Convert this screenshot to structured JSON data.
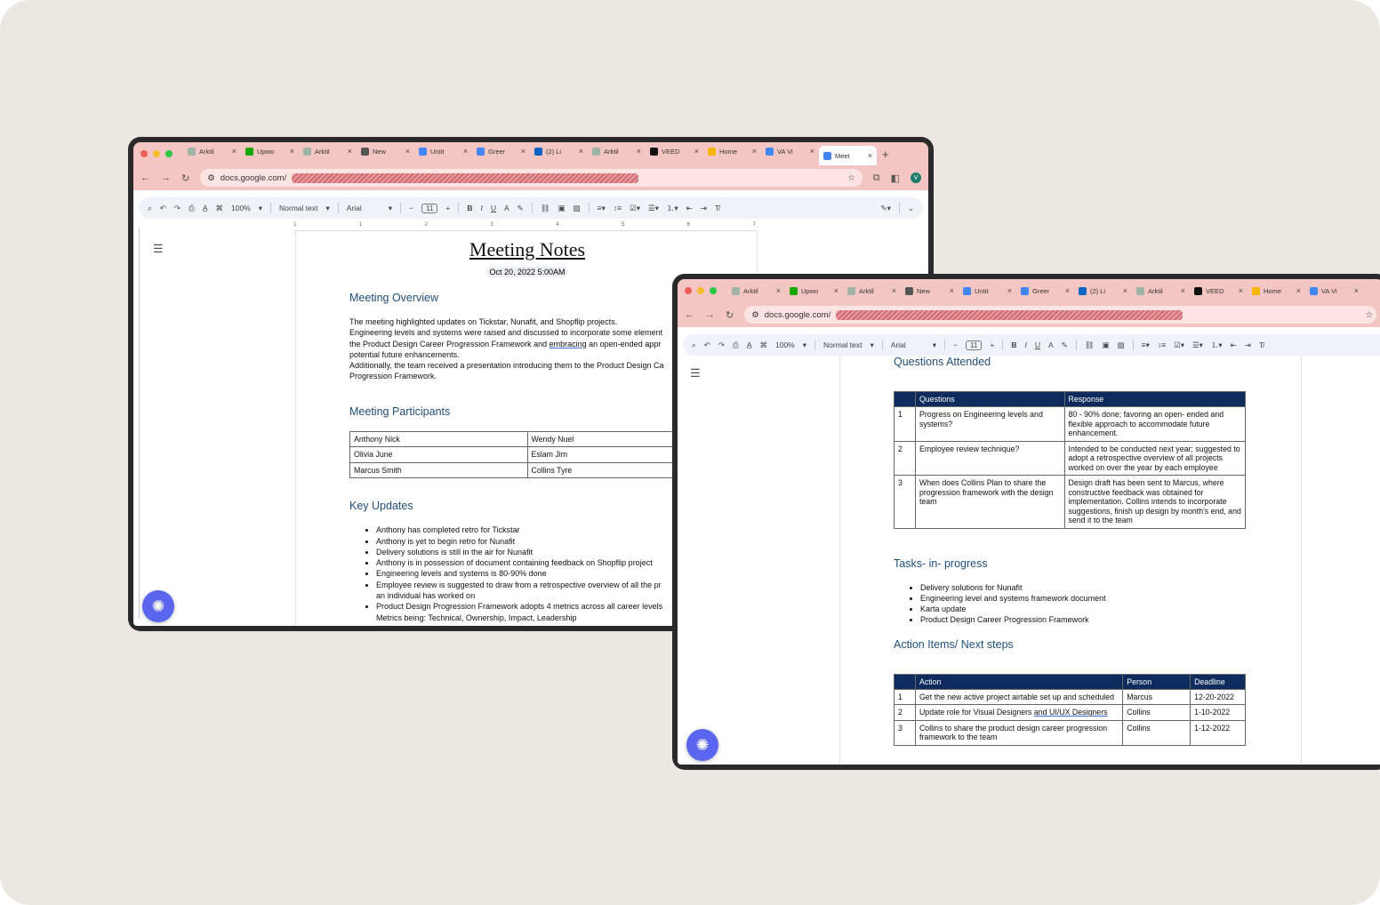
{
  "browser": {
    "tabs_back": [
      "Arktil",
      "Upwo",
      "Arktil",
      "New",
      "Untit",
      "Greer",
      "(2) Li",
      "Arktil",
      "VEED",
      "Home",
      "VA Vi",
      "Meet"
    ],
    "tabs_front": [
      "Arktil",
      "Upwo",
      "Arktil",
      "New",
      "Untit",
      "Greer",
      "(2) Li",
      "Arktil",
      "VEED",
      "Home",
      "VA Vi"
    ],
    "url": "docs.google.com/",
    "avatar": "V"
  },
  "toolbar": {
    "zoom": "100%",
    "style": "Normal text",
    "font": "Arial",
    "size": "11"
  },
  "ruler_marks": [
    "1",
    "1",
    "2",
    "3",
    "4",
    "5",
    "6",
    "7"
  ],
  "doc1": {
    "title": "Meeting Notes",
    "date": "Oct 20, 2022 5:00AM",
    "overview_heading": "Meeting Overview",
    "overview": [
      "The meeting highlighted updates on Tickstar, Nunafit, and Shopflip projects.",
      "Engineering levels and systems were raised and discussed to incorporate some element",
      "the Product Design Career Progression Framework and embracing an open-ended appr",
      "potential future enhancements.",
      "Additionally, the team received a presentation introducing them to the Product Design Ca",
      "Progression Framework."
    ],
    "participants_heading": "Meeting Participants",
    "participants": [
      [
        "Anthony Nick",
        "Wendy Nuel"
      ],
      [
        "Olivia June",
        "Eslam Jim"
      ],
      [
        "Marcus Smith",
        "Collins Tyre"
      ]
    ],
    "updates_heading": "Key Updates",
    "updates": [
      "Anthony has completed retro for Tickstar",
      "Anthony is yet to begin retro for Nunafit",
      "Delivery solutions is still in the air for Nunafit",
      "Anthony is in possession of document containing feedback on Shopflip project",
      "Engineering levels and systems is 80-90% done",
      "Employee review is suggested to draw from a retrospective overview of all the pr",
      "an individual has worked on",
      "Product Design Progression Framework adopts 4 metrics across all career levels",
      "Metrics being: Technical, Ownership, Impact, Leadership"
    ]
  },
  "doc2": {
    "questions_heading": "Questions Attended",
    "questions_header": [
      "",
      "Questions",
      "Response"
    ],
    "questions": [
      [
        "1",
        "Progress on Engineering levels and systems?",
        "80 - 90% done; favoring an open- ended and flexible approach to accommodate future enhancement."
      ],
      [
        "2",
        "Employee review technique?",
        "Intended to be conducted next year; suggested to adopt a retrospective overview of all projects worked on over the year by each employee"
      ],
      [
        "3",
        "When does Collins Plan to share the progression framework with the design team",
        "Design draft has been sent to Marcus, where constructive feedback was obtained for implementation. Collins intends to incorporate suggestions, finish up design by month's end, and send it to the team"
      ]
    ],
    "tasks_heading": "Tasks- in- progress",
    "tasks": [
      "Delivery solutions for Nunafit",
      "Engineering level and systems framework document",
      "Karta update",
      "Product Design Career Progression Framework"
    ],
    "actions_heading": "Action Items/ Next steps",
    "actions_header": [
      "",
      "Action",
      "Person",
      "Deadline"
    ],
    "actions": [
      [
        "1",
        "Get the new active project airtable set up and scheduled",
        "Marcus",
        "12-20-2022"
      ],
      [
        "2",
        "Update role for Visual Designers and UI/UX Designers",
        "Collins",
        "1-10-2022"
      ],
      [
        "3",
        "Collins to share the product design career progression framework to the team",
        "Collins",
        "1-12-2022"
      ]
    ]
  }
}
